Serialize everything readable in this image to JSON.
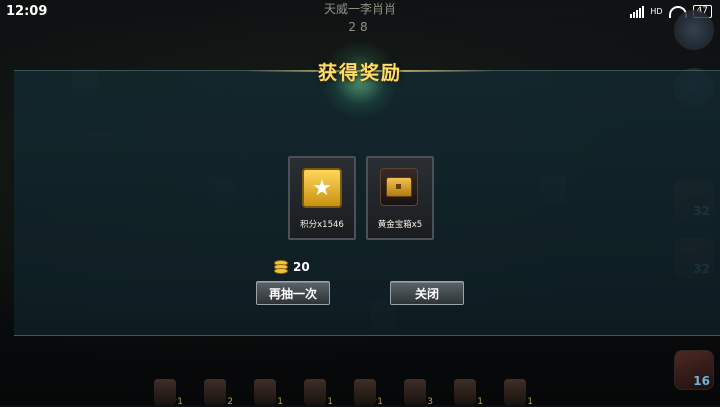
{
  "status_bar": {
    "time": "12:09",
    "network": "HD",
    "battery": "47"
  },
  "top": {
    "title": "天威一李肖肖",
    "number": "28"
  },
  "reward_dialog": {
    "title": "获得奖励",
    "items": [
      {
        "icon": "star-icon",
        "label": "积分x1546"
      },
      {
        "icon": "treasure-chest-icon",
        "label": "黄金宝箱x5"
      }
    ],
    "cost": {
      "icon": "gold-coin-icon",
      "amount": "20"
    },
    "buttons": {
      "redraw": "再抽一次",
      "close": "关闭"
    }
  },
  "right_rail": {
    "badges": [
      "32",
      "32",
      "16"
    ]
  },
  "bottom_bar": {
    "counts": [
      "1",
      "2",
      "1",
      "1",
      "1",
      "3",
      "1",
      "1"
    ]
  },
  "colors": {
    "title_gold": "#ffdd6a",
    "panel": "#12282e",
    "button": "#3e4649"
  }
}
